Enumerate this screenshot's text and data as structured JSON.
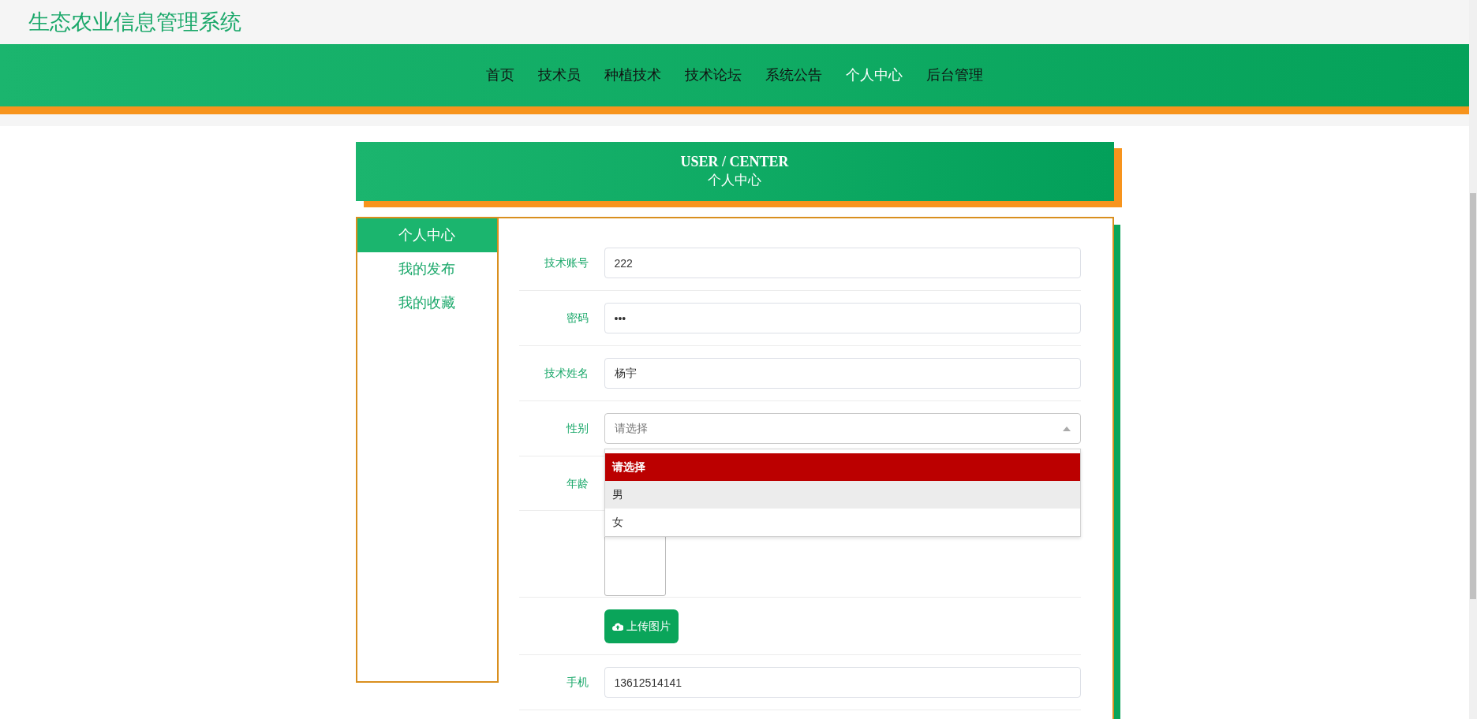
{
  "header": {
    "title": "生态农业信息管理系统"
  },
  "nav": [
    {
      "label": "首页",
      "selected": false
    },
    {
      "label": "技术员",
      "selected": false
    },
    {
      "label": "种植技术",
      "selected": false
    },
    {
      "label": "技术论坛",
      "selected": false
    },
    {
      "label": "系统公告",
      "selected": false
    },
    {
      "label": "个人中心",
      "selected": true
    },
    {
      "label": "后台管理",
      "selected": false
    }
  ],
  "banner": {
    "title": "USER / CENTER",
    "subtitle": "个人中心"
  },
  "sidebar": {
    "items": [
      {
        "label": "个人中心",
        "selected": true
      },
      {
        "label": "我的发布",
        "selected": false
      },
      {
        "label": "我的收藏",
        "selected": false
      }
    ]
  },
  "form": {
    "fields": [
      {
        "kind": "input",
        "label": "技术账号",
        "value": "222"
      },
      {
        "kind": "input",
        "label": "密码",
        "value": "•••"
      },
      {
        "kind": "input",
        "label": "技术姓名",
        "value": "杨宇"
      },
      {
        "kind": "select",
        "label": "性别",
        "placeholder": "请选择",
        "expanded": true,
        "options": [
          {
            "label": "请选择",
            "selected": true,
            "hovered": false
          },
          {
            "label": "男",
            "selected": false,
            "hovered": true
          },
          {
            "label": "女",
            "selected": false,
            "hovered": false
          }
        ]
      },
      {
        "kind": "covered",
        "label": "年龄"
      },
      {
        "kind": "image"
      },
      {
        "kind": "upload",
        "button": "上传图片"
      },
      {
        "kind": "input",
        "label": "手机",
        "value": "13612514141"
      }
    ]
  }
}
